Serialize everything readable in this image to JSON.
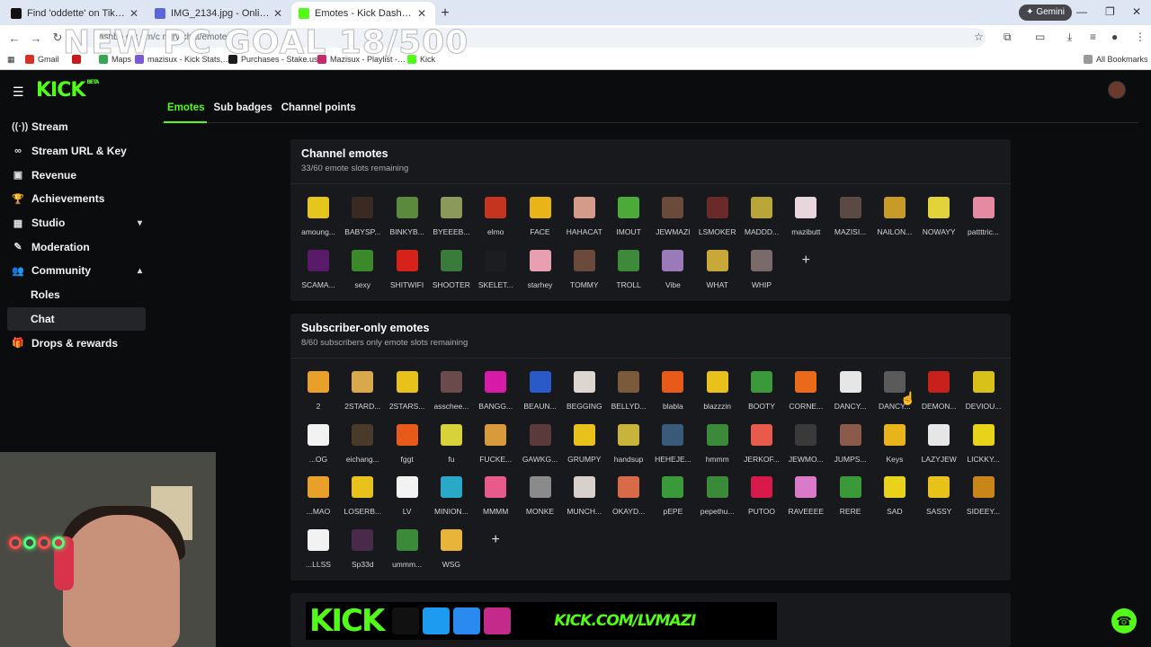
{
  "browser": {
    "tabs": [
      {
        "title": "Find 'oddette' on TikTok | TikTok",
        "color": "#111111"
      },
      {
        "title": "IMG_2134.jpg - Online image re…",
        "color": "#5a67d8"
      },
      {
        "title": "Emotes - Kick Dashboard",
        "color": "#53fc18"
      }
    ],
    "gemini_label": "Gemini",
    "url": "ashbo   d k om/c m  ry/chat/emotes",
    "bookmarks": [
      "Gmail",
      "",
      "Maps",
      "mazisux - Kick Stats,…",
      "Purchases - Stake.us",
      "Mazisux - Playlist -…",
      "Kick"
    ],
    "all_bookmarks": "All Bookmarks"
  },
  "stream_overlay": {
    "goal_text": "NEW PC GOAL 18/500",
    "banner_kick": "KICK",
    "banner_url": "KICK.COM/LVMAZI"
  },
  "app": {
    "logo": "KICK",
    "logo_badge": "BETA",
    "sidebar": [
      {
        "label": "Stream",
        "icon": "broadcast-icon",
        "glyph": "((·))"
      },
      {
        "label": "Stream URL & Key",
        "icon": "link-icon",
        "glyph": "∞"
      },
      {
        "label": "Revenue",
        "icon": "money-icon",
        "glyph": "▣"
      },
      {
        "label": "Achievements",
        "icon": "trophy-icon",
        "glyph": "🏆"
      },
      {
        "label": "Studio",
        "icon": "studio-icon",
        "glyph": "▦",
        "chev": "▾"
      },
      {
        "label": "Moderation",
        "icon": "wrench-icon",
        "glyph": "✎"
      },
      {
        "label": "Community",
        "icon": "community-icon",
        "glyph": "👥",
        "chev": "▴"
      }
    ],
    "sidebar_sub": [
      "Roles",
      "Chat"
    ],
    "sidebar_last": {
      "label": "Drops & rewards",
      "icon": "gift-icon",
      "glyph": "🎁"
    },
    "tabs": [
      "Emotes",
      "Sub badges",
      "Channel points"
    ],
    "channel_emotes": {
      "title": "Channel emotes",
      "subtitle": "33/60 emote slots remaining",
      "items": [
        {
          "name": "amoung...",
          "color": "#e6c51f"
        },
        {
          "name": "BABYSP...",
          "color": "#3a2b22"
        },
        {
          "name": "BINKYB...",
          "color": "#5b8a3c"
        },
        {
          "name": "BYEEEB...",
          "color": "#8b9a5a"
        },
        {
          "name": "elmo",
          "color": "#c4341e"
        },
        {
          "name": "FACE",
          "color": "#e8b418"
        },
        {
          "name": "HAHACAT",
          "color": "#d49a8a"
        },
        {
          "name": "IMOUT",
          "color": "#4caa3a"
        },
        {
          "name": "JEWMAZI",
          "color": "#6a4a3a"
        },
        {
          "name": "LSMOKER",
          "color": "#6a2a2a"
        },
        {
          "name": "MADDD...",
          "color": "#b8a638"
        },
        {
          "name": "mazibutt",
          "color": "#e7d6dc"
        },
        {
          "name": "MAZISI...",
          "color": "#5b4a44"
        },
        {
          "name": "NAILON...",
          "color": "#c89a28"
        },
        {
          "name": "NOWAYY",
          "color": "#e3d33a"
        },
        {
          "name": "pattttric...",
          "color": "#e58aa0"
        },
        {
          "name": "SCAMA...",
          "color": "#5a1a6a"
        },
        {
          "name": "sexy",
          "color": "#3a8a2a"
        },
        {
          "name": "SHITWIFI",
          "color": "#d6221a"
        },
        {
          "name": "SHOOTER",
          "color": "#3a7a3a"
        },
        {
          "name": "SKELET...",
          "color": "#1c1d20"
        },
        {
          "name": "starhey",
          "color": "#e8a0b0"
        },
        {
          "name": "TOMMY",
          "color": "#6a4a3a"
        },
        {
          "name": "TROLL",
          "color": "#3c8a3a"
        },
        {
          "name": "Vibe",
          "color": "#9a7ab8"
        },
        {
          "name": "WHAT",
          "color": "#c8a838"
        },
        {
          "name": "WHIP",
          "color": "#7a6a6a"
        }
      ],
      "add_label": "+"
    },
    "subscriber_emotes": {
      "title": "Subscriber-only emotes",
      "subtitle": "8/60 subscribers only emote slots remaining",
      "items": [
        {
          "name": "2",
          "color": "#e8a02a"
        },
        {
          "name": "2STARD...",
          "color": "#d8a84a"
        },
        {
          "name": "2STARS...",
          "color": "#e8c21a"
        },
        {
          "name": "asschee...",
          "color": "#6a4a4a"
        },
        {
          "name": "BANGG...",
          "color": "#d81aa8"
        },
        {
          "name": "BEAUN...",
          "color": "#2a5ac8"
        },
        {
          "name": "BEGGING",
          "color": "#ddd6d0"
        },
        {
          "name": "BELLYD...",
          "color": "#7a5a3a"
        },
        {
          "name": "blabla",
          "color": "#e85a1a"
        },
        {
          "name": "blazzzin",
          "color": "#e8c21a"
        },
        {
          "name": "BOOTY",
          "color": "#3a9a3a"
        },
        {
          "name": "CORNE...",
          "color": "#e86a1a"
        },
        {
          "name": "DANCY...",
          "color": "#e6e6e6"
        },
        {
          "name": "DANCY...",
          "color": "#5a5a5a"
        },
        {
          "name": "DEMON...",
          "color": "#c8201a"
        },
        {
          "name": "DEVIOU...",
          "color": "#d8c21a"
        },
        {
          "name": "...OG",
          "color": "#f2f2f2"
        },
        {
          "name": "eichang...",
          "color": "#4a3a2a"
        },
        {
          "name": "fggt",
          "color": "#e85a1a"
        },
        {
          "name": "fu",
          "color": "#d8d23a"
        },
        {
          "name": "FUCKE...",
          "color": "#d89a3a"
        },
        {
          "name": "GAWKG...",
          "color": "#5a3a3a"
        },
        {
          "name": "GRUMPY",
          "color": "#e8c21a"
        },
        {
          "name": "handsup",
          "color": "#c8b43a"
        },
        {
          "name": "HEHEJE...",
          "color": "#3a5a7a"
        },
        {
          "name": "hmmm",
          "color": "#3a8a3a"
        },
        {
          "name": "JERKOF...",
          "color": "#e85a4a"
        },
        {
          "name": "JEWMO...",
          "color": "#3a3a3a"
        },
        {
          "name": "JUMPS...",
          "color": "#8a5a4a"
        },
        {
          "name": "Keys",
          "color": "#e8b41a"
        },
        {
          "name": "LAZYJEW",
          "color": "#e6e6e6"
        },
        {
          "name": "LICKKY...",
          "color": "#e8d21a"
        },
        {
          "name": "...MAO",
          "color": "#e8a02a"
        },
        {
          "name": "LOSERB...",
          "color": "#e8c21a"
        },
        {
          "name": "LV",
          "color": "#f2f2f2"
        },
        {
          "name": "MINION...",
          "color": "#2aa8c8"
        },
        {
          "name": "MMMM",
          "color": "#e85a8a"
        },
        {
          "name": "MONKE",
          "color": "#8a8a8a"
        },
        {
          "name": "MUNCH...",
          "color": "#d8d0cc"
        },
        {
          "name": "OKAYD...",
          "color": "#d86a4a"
        },
        {
          "name": "pEPE",
          "color": "#3a9a3a"
        },
        {
          "name": "pepethu...",
          "color": "#3a8a3a"
        },
        {
          "name": "PUTOO",
          "color": "#d81a4a"
        },
        {
          "name": "RAVEEEE",
          "color": "#d87ac8"
        },
        {
          "name": "RERE",
          "color": "#3a9a3a"
        },
        {
          "name": "SAD",
          "color": "#e8d21a"
        },
        {
          "name": "SASSY",
          "color": "#e8c21a"
        },
        {
          "name": "SIDEEY...",
          "color": "#c8861a"
        },
        {
          "name": "...LLSS",
          "color": "#f2f2f2"
        },
        {
          "name": "Sp33d",
          "color": "#4a2a4a"
        },
        {
          "name": "ummm...",
          "color": "#3a8a3a"
        },
        {
          "name": "WSG",
          "color": "#e8b43a"
        }
      ],
      "add_label": "+"
    }
  },
  "colors": {
    "accent": "#53fc18",
    "bg": "#0b0c0e",
    "card": "#18191c"
  }
}
